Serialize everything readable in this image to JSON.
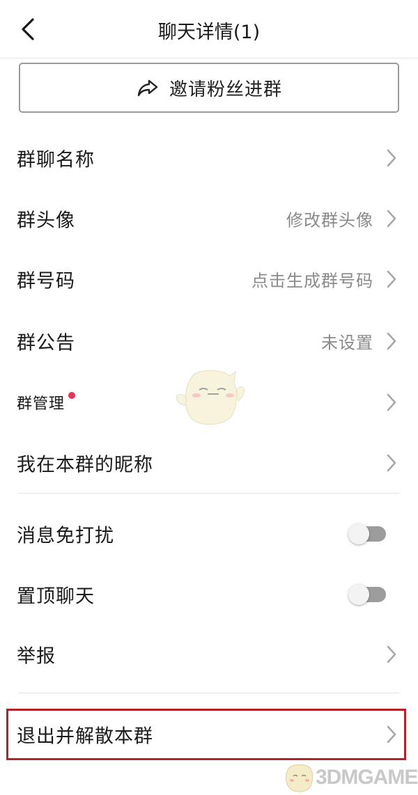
{
  "header": {
    "title": "聊天详情(1)",
    "back_icon": "chevron-left-icon"
  },
  "invite": {
    "label": "邀请粉丝进群",
    "icon": "share-icon"
  },
  "settings": {
    "group_name": {
      "label": "群聊名称"
    },
    "group_avatar": {
      "label": "群头像",
      "value": "修改群头像"
    },
    "group_number": {
      "label": "群号码",
      "value": "点击生成群号码"
    },
    "group_notice": {
      "label": "群公告",
      "value": "未设置"
    },
    "group_manage": {
      "label": "群管理",
      "has_red_dot": true
    },
    "my_nickname": {
      "label": "我在本群的昵称"
    },
    "mute": {
      "label": "消息免打扰",
      "on": false
    },
    "pin": {
      "label": "置顶聊天",
      "on": false
    },
    "report": {
      "label": "举报"
    },
    "quit": {
      "label": "退出并解散本群"
    }
  },
  "watermark": {
    "text": "3DMGAME"
  },
  "colors": {
    "highlight_border": "#b42228",
    "red_dot": "#e8355a",
    "value_text": "#8a8a8a",
    "toggle_off": "#9c9c9c"
  }
}
